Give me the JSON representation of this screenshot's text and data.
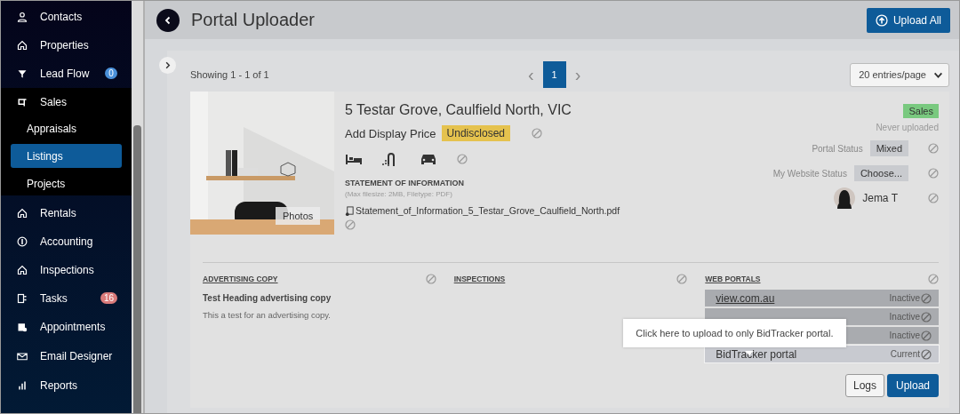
{
  "sidebar": {
    "items": [
      {
        "label": "Contacts",
        "selected": false
      },
      {
        "label": "Properties",
        "selected": false
      },
      {
        "label": "Lead Flow",
        "selected": false,
        "badge": "0",
        "color": "#4a90d9"
      },
      {
        "label": "Sales",
        "selected": false,
        "expanded": true,
        "children": [
          {
            "label": "Appraisals",
            "selected": false
          },
          {
            "label": "Listings",
            "selected": true
          },
          {
            "label": "Projects",
            "selected": false
          }
        ]
      },
      {
        "label": "Rentals",
        "selected": false
      },
      {
        "label": "Accounting",
        "selected": false
      },
      {
        "label": "Inspections",
        "selected": false
      },
      {
        "label": "Tasks",
        "selected": false,
        "badge": "16",
        "color": "#d97a7a"
      },
      {
        "label": "Appointments",
        "selected": false
      },
      {
        "label": "Email Designer",
        "selected": false
      },
      {
        "label": "Reports",
        "selected": false
      }
    ]
  },
  "header": {
    "title": "Portal Uploader",
    "upload_all": "Upload All"
  },
  "pager": {
    "showing": "Showing 1 - 1 of 1",
    "prev": "‹",
    "next": "›",
    "pages": [
      {
        "label": "1",
        "selected": true
      }
    ],
    "per_page": "20 entries/page"
  },
  "listing": {
    "address": "5 Testar Grove, Caulfield North, VIC",
    "price_label": "Add Display Price",
    "price_badge": "Undisclosed",
    "type_badge": "Sales",
    "upload_status": "Never uploaded",
    "soi": {
      "title": "STATEMENT OF INFORMATION",
      "hint": "(Max filesize: 2MB, Filetype: PDF)",
      "file": "Statement_of_Information_5_Testar_Grove_Caulfield_North.pdf"
    },
    "photos_button": "Photos",
    "portal_status": {
      "label": "Portal Status",
      "value": "Mixed"
    },
    "website_status": {
      "label": "My Website Status",
      "value": "Choose..."
    },
    "agent": "Jema T"
  },
  "advertising": {
    "title": "ADVERTISING COPY",
    "heading": "Test Heading advertising copy",
    "body": "This a test for an advertising copy."
  },
  "inspections": {
    "title": "INSPECTIONS"
  },
  "web_portals": {
    "title": "WEB PORTALS",
    "rows": [
      {
        "name": "view.com.au",
        "status": "Inactive",
        "current": false
      },
      {
        "status": "Inactive",
        "current": false
      },
      {
        "status": "Inactive",
        "current": false
      },
      {
        "name": "BidTracker portal",
        "status": "Current",
        "current": true
      }
    ]
  },
  "tooltip": "Click here to upload to only BidTracker portal.",
  "buttons": {
    "logs": "Logs",
    "upload": "Upload"
  }
}
